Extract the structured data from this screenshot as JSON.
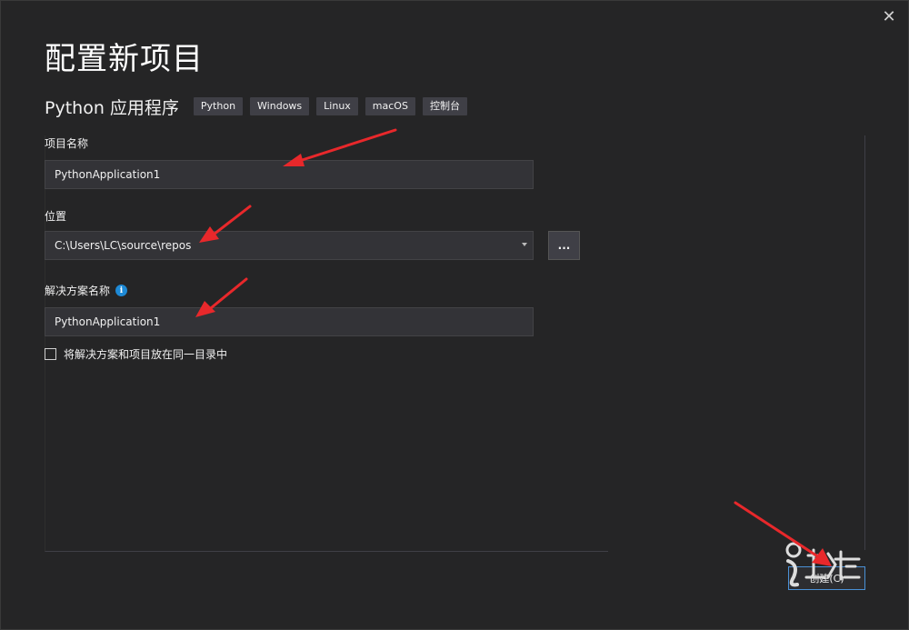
{
  "dialog": {
    "title": "配置新项目",
    "close_glyph": "✕"
  },
  "template": {
    "name": "Python 应用程序",
    "tags": [
      "Python",
      "Windows",
      "Linux",
      "macOS",
      "控制台"
    ]
  },
  "fields": {
    "project_name": {
      "label": "项目名称",
      "value": "PythonApplication1"
    },
    "location": {
      "label": "位置",
      "value": "C:\\Users\\LC\\source\\repos",
      "browse_label": "..."
    },
    "solution_name": {
      "label": "解决方案名称",
      "value": "PythonApplication1",
      "info_glyph": "i"
    },
    "same_dir": {
      "label": "将解决方案和项目放在同一目录中",
      "checked": false
    }
  },
  "footer": {
    "create_label": "创建(C)"
  },
  "colors": {
    "background": "#252526",
    "input_bg": "#333337",
    "tag_bg": "#3f3f46",
    "accent_border": "#4a90d6",
    "annotation_arrow": "#e8282b",
    "info_icon": "#1e8ad6"
  }
}
